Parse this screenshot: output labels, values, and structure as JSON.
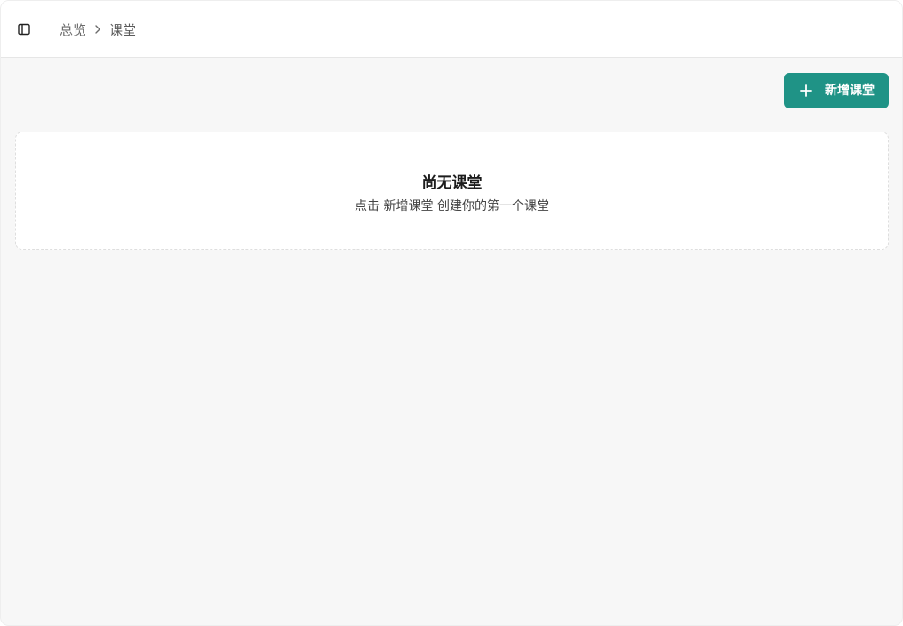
{
  "header": {
    "sidebar_toggle_icon": "sidebar-panel-icon",
    "breadcrumb": {
      "root_label": "总览",
      "separator_icon": "chevron-right-icon",
      "current_label": "课堂"
    }
  },
  "toolbar": {
    "add_button_icon": "plus-icon",
    "add_button_label": "新增课堂"
  },
  "empty_state": {
    "title": "尚无课堂",
    "description": "点击 新增课堂 创建你的第一个课堂"
  },
  "colors": {
    "accent": "#1f9386",
    "page_background": "#f7f7f7",
    "header_background": "#ffffff"
  }
}
